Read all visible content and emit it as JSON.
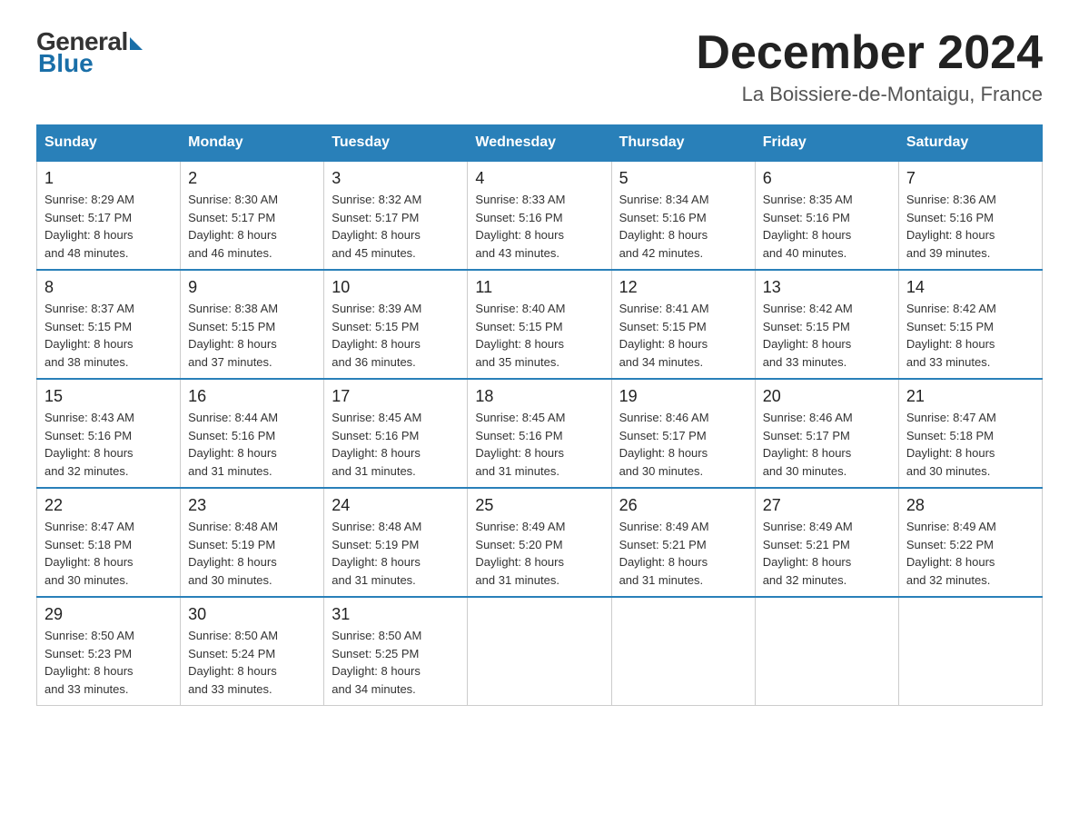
{
  "logo": {
    "general": "General",
    "blue": "Blue"
  },
  "title": "December 2024",
  "location": "La Boissiere-de-Montaigu, France",
  "days_of_week": [
    "Sunday",
    "Monday",
    "Tuesday",
    "Wednesday",
    "Thursday",
    "Friday",
    "Saturday"
  ],
  "weeks": [
    [
      {
        "day": "1",
        "sunrise": "8:29 AM",
        "sunset": "5:17 PM",
        "daylight": "8 hours and 48 minutes."
      },
      {
        "day": "2",
        "sunrise": "8:30 AM",
        "sunset": "5:17 PM",
        "daylight": "8 hours and 46 minutes."
      },
      {
        "day": "3",
        "sunrise": "8:32 AM",
        "sunset": "5:17 PM",
        "daylight": "8 hours and 45 minutes."
      },
      {
        "day": "4",
        "sunrise": "8:33 AM",
        "sunset": "5:16 PM",
        "daylight": "8 hours and 43 minutes."
      },
      {
        "day": "5",
        "sunrise": "8:34 AM",
        "sunset": "5:16 PM",
        "daylight": "8 hours and 42 minutes."
      },
      {
        "day": "6",
        "sunrise": "8:35 AM",
        "sunset": "5:16 PM",
        "daylight": "8 hours and 40 minutes."
      },
      {
        "day": "7",
        "sunrise": "8:36 AM",
        "sunset": "5:16 PM",
        "daylight": "8 hours and 39 minutes."
      }
    ],
    [
      {
        "day": "8",
        "sunrise": "8:37 AM",
        "sunset": "5:15 PM",
        "daylight": "8 hours and 38 minutes."
      },
      {
        "day": "9",
        "sunrise": "8:38 AM",
        "sunset": "5:15 PM",
        "daylight": "8 hours and 37 minutes."
      },
      {
        "day": "10",
        "sunrise": "8:39 AM",
        "sunset": "5:15 PM",
        "daylight": "8 hours and 36 minutes."
      },
      {
        "day": "11",
        "sunrise": "8:40 AM",
        "sunset": "5:15 PM",
        "daylight": "8 hours and 35 minutes."
      },
      {
        "day": "12",
        "sunrise": "8:41 AM",
        "sunset": "5:15 PM",
        "daylight": "8 hours and 34 minutes."
      },
      {
        "day": "13",
        "sunrise": "8:42 AM",
        "sunset": "5:15 PM",
        "daylight": "8 hours and 33 minutes."
      },
      {
        "day": "14",
        "sunrise": "8:42 AM",
        "sunset": "5:15 PM",
        "daylight": "8 hours and 33 minutes."
      }
    ],
    [
      {
        "day": "15",
        "sunrise": "8:43 AM",
        "sunset": "5:16 PM",
        "daylight": "8 hours and 32 minutes."
      },
      {
        "day": "16",
        "sunrise": "8:44 AM",
        "sunset": "5:16 PM",
        "daylight": "8 hours and 31 minutes."
      },
      {
        "day": "17",
        "sunrise": "8:45 AM",
        "sunset": "5:16 PM",
        "daylight": "8 hours and 31 minutes."
      },
      {
        "day": "18",
        "sunrise": "8:45 AM",
        "sunset": "5:16 PM",
        "daylight": "8 hours and 31 minutes."
      },
      {
        "day": "19",
        "sunrise": "8:46 AM",
        "sunset": "5:17 PM",
        "daylight": "8 hours and 30 minutes."
      },
      {
        "day": "20",
        "sunrise": "8:46 AM",
        "sunset": "5:17 PM",
        "daylight": "8 hours and 30 minutes."
      },
      {
        "day": "21",
        "sunrise": "8:47 AM",
        "sunset": "5:18 PM",
        "daylight": "8 hours and 30 minutes."
      }
    ],
    [
      {
        "day": "22",
        "sunrise": "8:47 AM",
        "sunset": "5:18 PM",
        "daylight": "8 hours and 30 minutes."
      },
      {
        "day": "23",
        "sunrise": "8:48 AM",
        "sunset": "5:19 PM",
        "daylight": "8 hours and 30 minutes."
      },
      {
        "day": "24",
        "sunrise": "8:48 AM",
        "sunset": "5:19 PM",
        "daylight": "8 hours and 31 minutes."
      },
      {
        "day": "25",
        "sunrise": "8:49 AM",
        "sunset": "5:20 PM",
        "daylight": "8 hours and 31 minutes."
      },
      {
        "day": "26",
        "sunrise": "8:49 AM",
        "sunset": "5:21 PM",
        "daylight": "8 hours and 31 minutes."
      },
      {
        "day": "27",
        "sunrise": "8:49 AM",
        "sunset": "5:21 PM",
        "daylight": "8 hours and 32 minutes."
      },
      {
        "day": "28",
        "sunrise": "8:49 AM",
        "sunset": "5:22 PM",
        "daylight": "8 hours and 32 minutes."
      }
    ],
    [
      {
        "day": "29",
        "sunrise": "8:50 AM",
        "sunset": "5:23 PM",
        "daylight": "8 hours and 33 minutes."
      },
      {
        "day": "30",
        "sunrise": "8:50 AM",
        "sunset": "5:24 PM",
        "daylight": "8 hours and 33 minutes."
      },
      {
        "day": "31",
        "sunrise": "8:50 AM",
        "sunset": "5:25 PM",
        "daylight": "8 hours and 34 minutes."
      },
      null,
      null,
      null,
      null
    ]
  ],
  "sunrise_label": "Sunrise:",
  "sunset_label": "Sunset:",
  "daylight_label": "Daylight:"
}
